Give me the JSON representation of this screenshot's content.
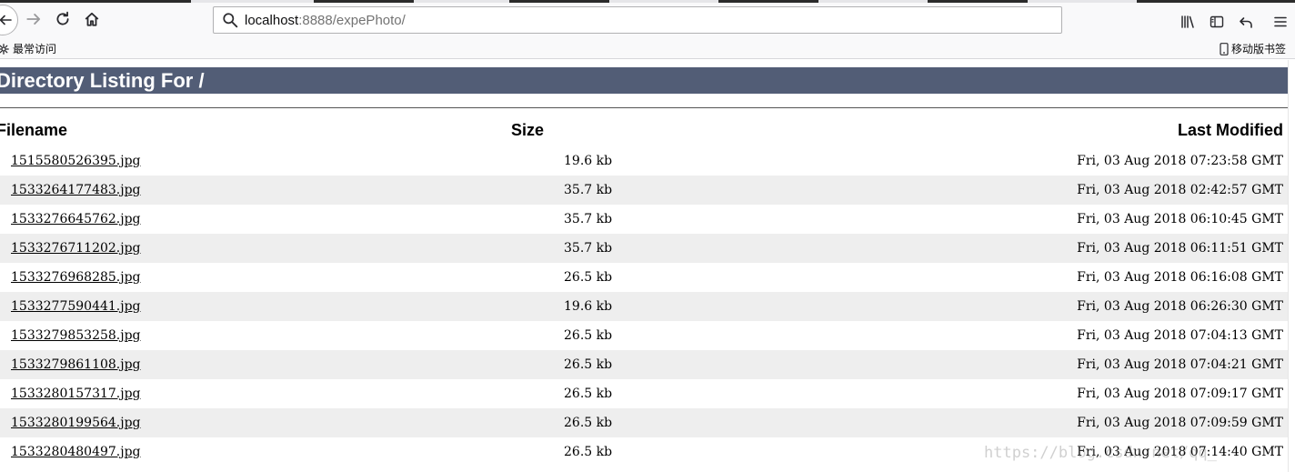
{
  "browser": {
    "url_host": "localhost",
    "url_rest": ":8888/expePhoto/",
    "bookmarks_left": "最常访问",
    "bookmarks_right": "移动版书签"
  },
  "icons": {
    "back": "back-arrow-icon",
    "forward": "forward-arrow-icon",
    "reload": "reload-icon",
    "home": "home-icon",
    "search": "search-icon",
    "library": "library-icon",
    "sidebar": "sidebar-icon",
    "undo": "undo-icon",
    "menu": "hamburger-menu-icon",
    "gear": "gear-icon",
    "mobile": "mobile-phone-icon"
  },
  "colors": {
    "title_bar": "#525d76",
    "row_alt": "#eeeeee"
  },
  "listing": {
    "title": "Directory Listing For /",
    "headers": {
      "filename": "Filename",
      "size": "Size",
      "modified": "Last Modified"
    },
    "files": [
      {
        "name": "1515580526395.jpg",
        "size": "19.6 kb",
        "modified": "Fri, 03 Aug 2018 07:23:58 GMT"
      },
      {
        "name": "1533264177483.jpg",
        "size": "35.7 kb",
        "modified": "Fri, 03 Aug 2018 02:42:57 GMT"
      },
      {
        "name": "1533276645762.jpg",
        "size": "35.7 kb",
        "modified": "Fri, 03 Aug 2018 06:10:45 GMT"
      },
      {
        "name": "1533276711202.jpg",
        "size": "35.7 kb",
        "modified": "Fri, 03 Aug 2018 06:11:51 GMT"
      },
      {
        "name": "1533276968285.jpg",
        "size": "26.5 kb",
        "modified": "Fri, 03 Aug 2018 06:16:08 GMT"
      },
      {
        "name": "1533277590441.jpg",
        "size": "19.6 kb",
        "modified": "Fri, 03 Aug 2018 06:26:30 GMT"
      },
      {
        "name": "1533279853258.jpg",
        "size": "26.5 kb",
        "modified": "Fri, 03 Aug 2018 07:04:13 GMT"
      },
      {
        "name": "1533279861108.jpg",
        "size": "26.5 kb",
        "modified": "Fri, 03 Aug 2018 07:04:21 GMT"
      },
      {
        "name": "1533280157317.jpg",
        "size": "26.5 kb",
        "modified": "Fri, 03 Aug 2018 07:09:17 GMT"
      },
      {
        "name": "1533280199564.jpg",
        "size": "26.5 kb",
        "modified": "Fri, 03 Aug 2018 07:09:59 GMT"
      },
      {
        "name": "1533280480497.jpg",
        "size": "26.5 kb",
        "modified": "Fri, 03 Aug 2018 07:14:40 GMT"
      }
    ]
  },
  "watermark": "https://blog.csdn.net/qq_"
}
